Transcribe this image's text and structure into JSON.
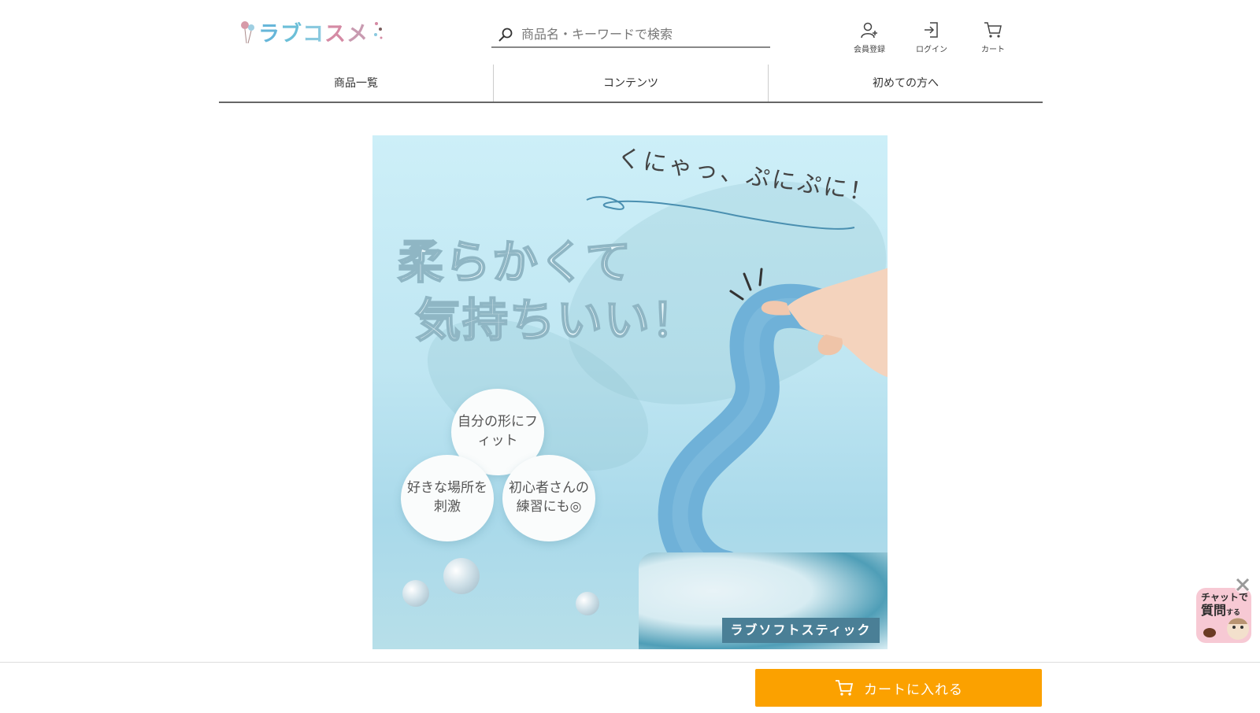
{
  "header": {
    "logo_text": [
      "ラ",
      "ブ",
      "コ",
      "ス",
      "メ"
    ],
    "search_placeholder": "商品名・キーワードで検索",
    "icons": [
      {
        "label": "会員登録",
        "icon": "user-add-icon"
      },
      {
        "label": "ログイン",
        "icon": "login-icon"
      },
      {
        "label": "カート",
        "icon": "cart-icon"
      }
    ]
  },
  "nav": {
    "items": [
      "商品一覧",
      "コンテンツ",
      "初めての方へ"
    ]
  },
  "hero": {
    "tagline": "くにゃっ、ぷにぷに！",
    "title_line1": "柔らかくて",
    "title_line2": "気持ちいい！",
    "bubbles": [
      "自分の形にフィット",
      "好きな場所を刺激",
      "初心者さんの練習にも◎"
    ],
    "product_label": "ラブソフトスティック"
  },
  "footer": {
    "cart_button_label": "カートに入れる"
  },
  "chat": {
    "line1": "チャットで",
    "line2": "質問",
    "line2_suffix": "する"
  },
  "colors": {
    "accent": "#fba100",
    "hero_bg": "#c3e8f3",
    "product_blue": "#6fb1d8"
  }
}
